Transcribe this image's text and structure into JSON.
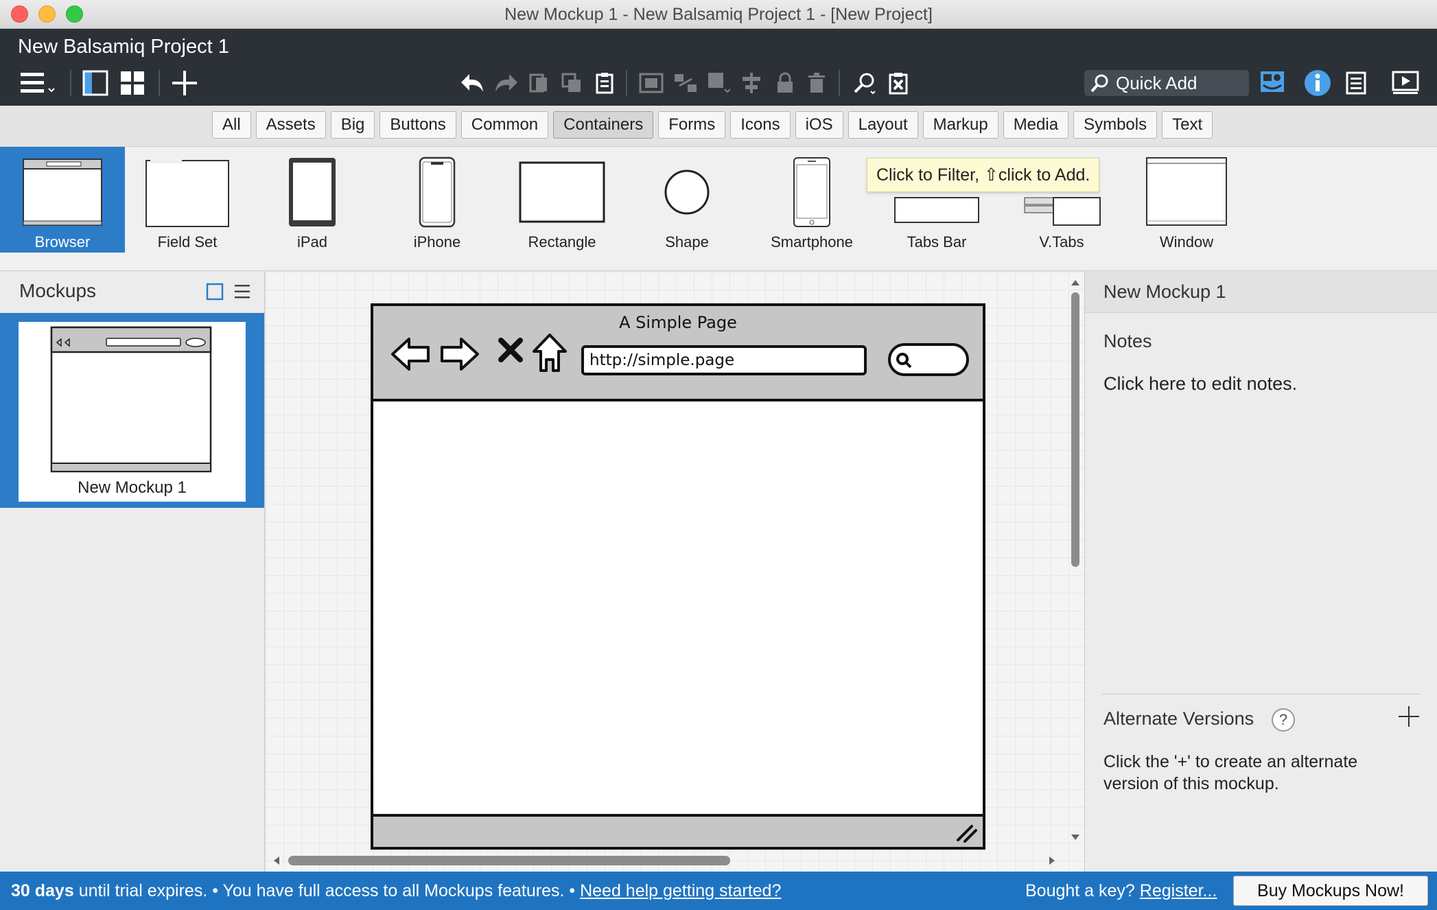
{
  "window": {
    "title": "New Mockup 1 - New Balsamiq Project 1 - [New Project]"
  },
  "header": {
    "project_title": "New Balsamiq Project 1",
    "quick_add_placeholder": "Quick Add",
    "toolbar_icons": [
      "menu-icon",
      "single-view-icon",
      "grid-view-icon",
      "add-icon",
      "undo-icon",
      "redo-icon",
      "copy-icon",
      "duplicate-icon",
      "paste-icon",
      "group-icon",
      "ungroup-icon",
      "arrange-icon",
      "align-icon",
      "lock-icon",
      "delete-icon",
      "find-icon",
      "clear-icon",
      "search-icon",
      "ui-library-icon",
      "info-icon",
      "document-icon",
      "present-icon"
    ]
  },
  "filters": {
    "active": "Containers",
    "items": [
      "All",
      "Assets",
      "Big",
      "Buttons",
      "Common",
      "Containers",
      "Forms",
      "Icons",
      "iOS",
      "Layout",
      "Markup",
      "Media",
      "Symbols",
      "Text"
    ]
  },
  "library": {
    "selected": "Browser",
    "items": [
      "Browser",
      "Field Set",
      "iPad",
      "iPhone",
      "Rectangle",
      "Shape",
      "Smartphone",
      "Tabs Bar",
      "V.Tabs",
      "Window"
    ],
    "tooltip": "Click to Filter, ⇧click to Add."
  },
  "left_panel": {
    "title": "Mockups",
    "mockups": [
      {
        "label": "New Mockup 1",
        "selected": true
      }
    ]
  },
  "canvas": {
    "browser_title": "A Simple Page",
    "browser_url": "http://simple.page"
  },
  "right_panel": {
    "mockup_name": "New Mockup 1",
    "notes_label": "Notes",
    "notes_placeholder": "Click here to edit notes.",
    "alternate_title": "Alternate Versions",
    "alternate_help": "?",
    "alternate_desc": "Click the '+' to create an alternate version of this mockup."
  },
  "status": {
    "days": "30 days",
    "trial_text": "until trial expires. • You have full access to all Mockups features. •",
    "help_link": "Need help getting started?",
    "key_text": "Bought a key?",
    "register_link": "Register...",
    "buy_label": "Buy Mockups Now!"
  },
  "colors": {
    "header_bg": "#2b3136",
    "selection_blue": "#2d7cc7",
    "status_bar": "#1f74c2",
    "tooltip_bg": "#fdfbd3",
    "info_blue": "#4aa0e8"
  }
}
